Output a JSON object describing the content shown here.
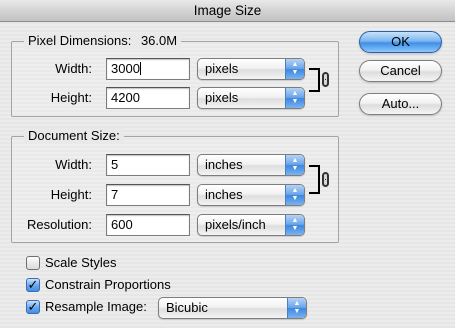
{
  "window": {
    "title": "Image Size"
  },
  "pixel_dimensions": {
    "legend": "Pixel Dimensions:",
    "size": "36.0M",
    "width_label": "Width:",
    "width_value": "3000",
    "width_unit": "pixels",
    "height_label": "Height:",
    "height_value": "4200",
    "height_unit": "pixels"
  },
  "document_size": {
    "legend": "Document Size:",
    "width_label": "Width:",
    "width_value": "5",
    "width_unit": "inches",
    "height_label": "Height:",
    "height_value": "7",
    "height_unit": "inches",
    "resolution_label": "Resolution:",
    "resolution_value": "600",
    "resolution_unit": "pixels/inch"
  },
  "options": {
    "scale_styles_label": "Scale Styles",
    "scale_styles_checked": false,
    "constrain_label": "Constrain Proportions",
    "constrain_checked": true,
    "resample_label": "Resample Image:",
    "resample_checked": true,
    "resample_method": "Bicubic"
  },
  "buttons": {
    "ok": "OK",
    "cancel": "Cancel",
    "auto": "Auto..."
  },
  "icons": {
    "link": "chain-link-icon",
    "check": "checkmark-icon",
    "popup_arrows": "up-down-arrows-icon"
  },
  "colors": {
    "accent": "#3f8fe6",
    "window_bg": "#e9e9e9"
  }
}
